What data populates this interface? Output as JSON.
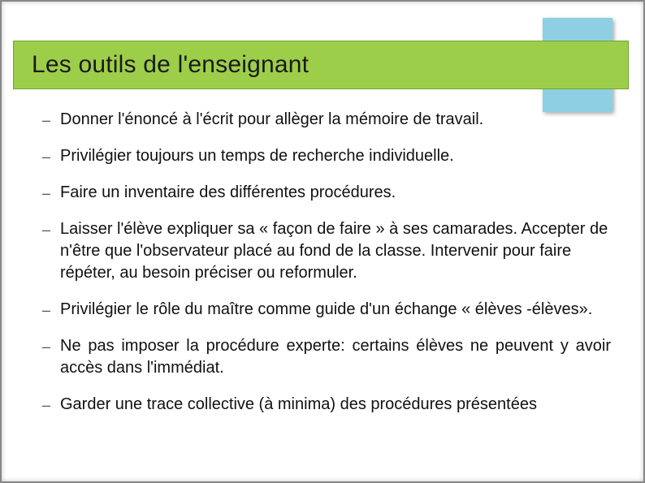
{
  "title": "Les outils de l'enseignant",
  "bullets": [
    {
      "text": "Donner l'énoncé à l'écrit pour allèger la mémoire de travail.",
      "justify": false
    },
    {
      "text": "Privilégier toujours un temps de recherche individuelle.",
      "justify": false
    },
    {
      "text": "Faire un inventaire des différentes procédures.",
      "justify": false
    },
    {
      "text": "Laisser l'élève expliquer sa « façon de faire » à ses camarades. Accepter de n'être que l'observateur placé au fond de la classe. Intervenir pour faire répéter, au besoin préciser ou reformuler.",
      "justify": false
    },
    {
      "text": "Privilégier le rôle du maître comme guide d'un échange « élèves -élèves».",
      "justify": false
    },
    {
      "text": "Ne pas imposer la procédure experte: certains élèves ne peuvent y avoir accès dans l'immédiat.",
      "justify": true
    },
    {
      "text": "Garder une trace collective (à minima) des procédures présentées",
      "justify": true
    }
  ],
  "dash": "–"
}
